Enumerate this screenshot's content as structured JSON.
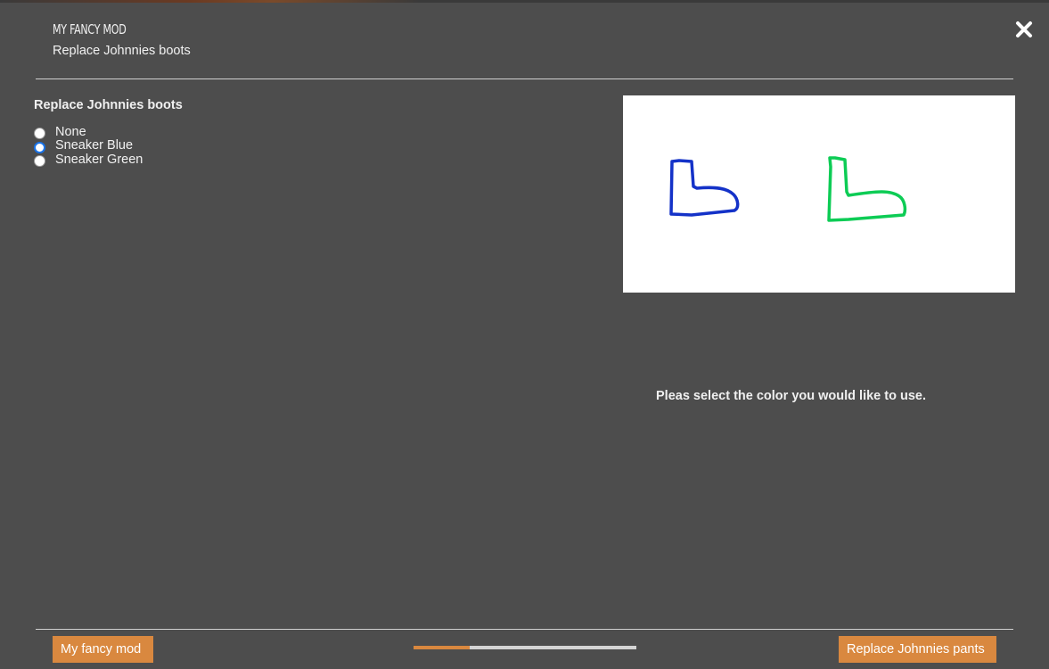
{
  "header": {
    "title": "MY FANCY MOD",
    "subtitle": "Replace Johnnies boots"
  },
  "step": {
    "group_title": "Replace Johnnies boots",
    "options": [
      {
        "label": "None",
        "selected": false
      },
      {
        "label": "Sneaker Blue",
        "selected": true
      },
      {
        "label": "Sneaker Green",
        "selected": false
      }
    ],
    "hint": "Pleas select the color you would like to use."
  },
  "preview": {
    "boot_colors": [
      "#1432c8",
      "#0dcc55"
    ]
  },
  "footer": {
    "prev_label": "My fancy mod",
    "next_label": "Replace Johnnies pants",
    "progress_fraction": 0.25
  },
  "colors": {
    "background": "#4d4d4d",
    "accent": "#d9883f",
    "radio_selected": "#1a73e8"
  },
  "icons": {
    "close": "close-icon"
  }
}
